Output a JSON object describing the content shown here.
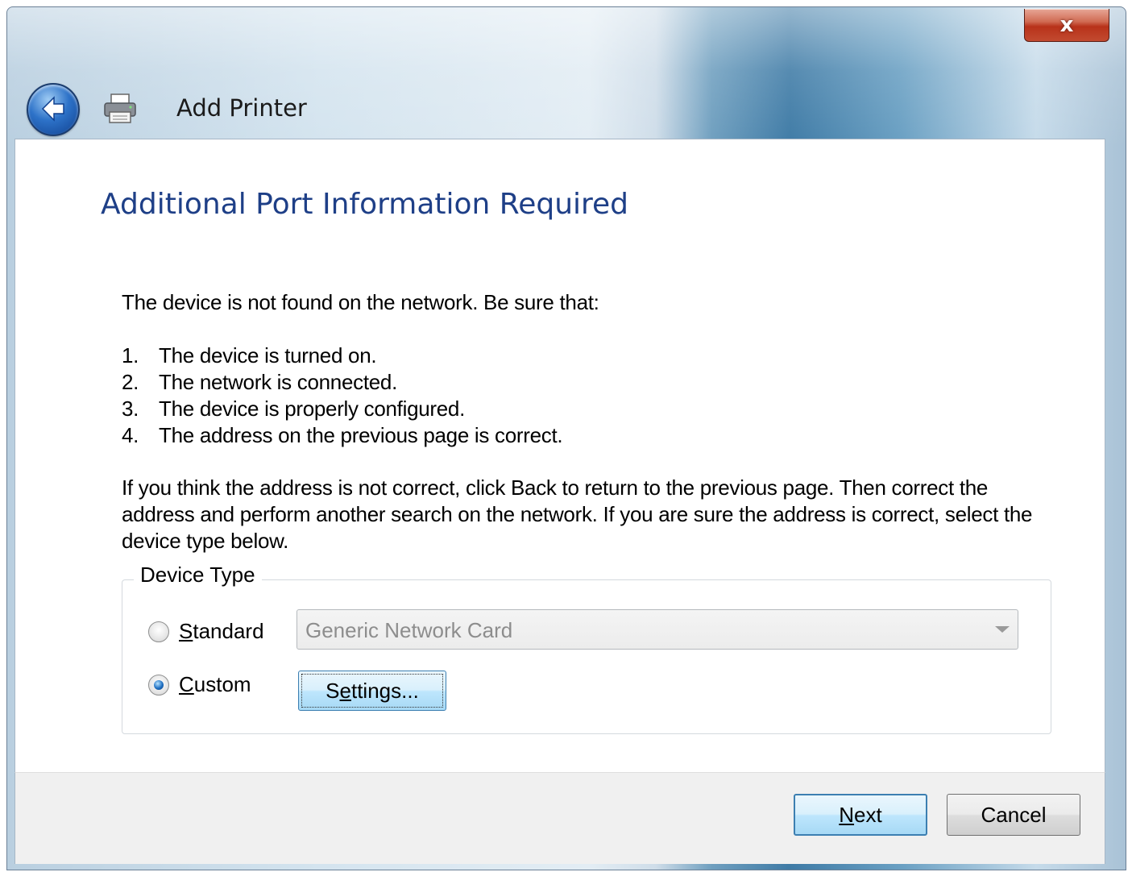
{
  "window": {
    "title": "Add Printer",
    "close_glyph": "x"
  },
  "icons": {
    "back": "back-arrow-icon",
    "printer": "printer-icon",
    "close": "close-icon"
  },
  "page": {
    "heading": "Additional Port Information Required",
    "intro": "The device is not found on the network.  Be sure that:",
    "checklist": [
      {
        "num": "1.",
        "text": "The device is turned on."
      },
      {
        "num": "2.",
        "text": "The network is connected."
      },
      {
        "num": "3.",
        "text": "The device is properly configured."
      },
      {
        "num": "4.",
        "text": "The address on the previous page is correct."
      }
    ],
    "advice": "If you think the address is not correct, click Back to return to the previous page.  Then correct the address and perform another search on the network.  If you are sure the address is correct, select the device type below."
  },
  "device_type": {
    "legend": "Device Type",
    "standard": {
      "label_underlined": "S",
      "label_rest": "tandard",
      "selected": false
    },
    "custom": {
      "label_underlined": "C",
      "label_rest": "ustom",
      "selected": true
    },
    "combo_value": "Generic Network Card",
    "settings_label_pre": "S",
    "settings_label_underlined": "e",
    "settings_label_post": "ttings..."
  },
  "footer": {
    "next_underlined": "N",
    "next_rest": "ext",
    "cancel_label": "Cancel"
  },
  "colors": {
    "heading": "#1e3f87",
    "accent_button": "#3c7fb1",
    "close_red": "#b8321a"
  }
}
